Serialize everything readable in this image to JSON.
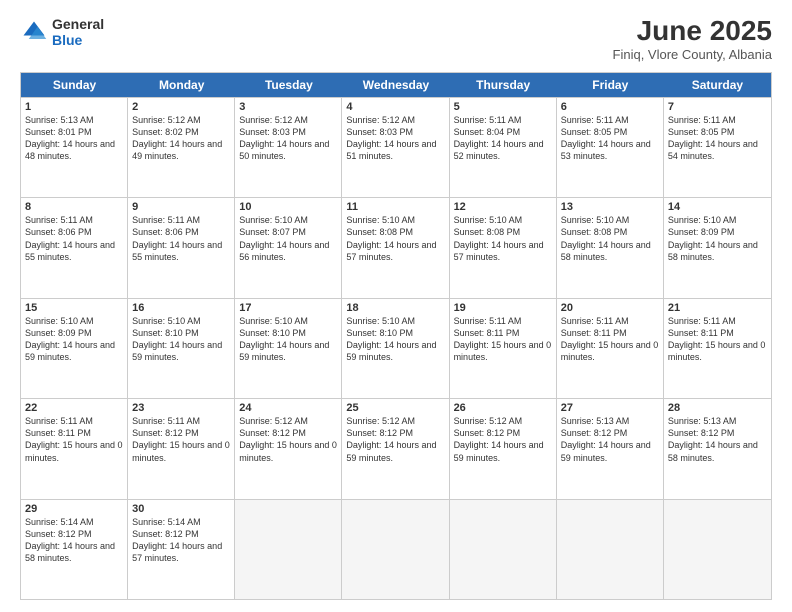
{
  "logo": {
    "general": "General",
    "blue": "Blue"
  },
  "title": {
    "month": "June 2025",
    "location": "Finiq, Vlore County, Albania"
  },
  "calendar": {
    "days": [
      "Sunday",
      "Monday",
      "Tuesday",
      "Wednesday",
      "Thursday",
      "Friday",
      "Saturday"
    ],
    "rows": [
      [
        {
          "day": "",
          "empty": true
        },
        {
          "day": "2",
          "sunrise": "5:12 AM",
          "sunset": "8:02 PM",
          "daylight": "14 hours and 49 minutes."
        },
        {
          "day": "3",
          "sunrise": "5:12 AM",
          "sunset": "8:03 PM",
          "daylight": "14 hours and 50 minutes."
        },
        {
          "day": "4",
          "sunrise": "5:12 AM",
          "sunset": "8:03 PM",
          "daylight": "14 hours and 51 minutes."
        },
        {
          "day": "5",
          "sunrise": "5:11 AM",
          "sunset": "8:04 PM",
          "daylight": "14 hours and 52 minutes."
        },
        {
          "day": "6",
          "sunrise": "5:11 AM",
          "sunset": "8:05 PM",
          "daylight": "14 hours and 53 minutes."
        },
        {
          "day": "7",
          "sunrise": "5:11 AM",
          "sunset": "8:05 PM",
          "daylight": "14 hours and 54 minutes."
        }
      ],
      [
        {
          "day": "8",
          "sunrise": "5:11 AM",
          "sunset": "8:06 PM",
          "daylight": "14 hours and 55 minutes."
        },
        {
          "day": "9",
          "sunrise": "5:11 AM",
          "sunset": "8:06 PM",
          "daylight": "14 hours and 55 minutes."
        },
        {
          "day": "10",
          "sunrise": "5:10 AM",
          "sunset": "8:07 PM",
          "daylight": "14 hours and 56 minutes."
        },
        {
          "day": "11",
          "sunrise": "5:10 AM",
          "sunset": "8:08 PM",
          "daylight": "14 hours and 57 minutes."
        },
        {
          "day": "12",
          "sunrise": "5:10 AM",
          "sunset": "8:08 PM",
          "daylight": "14 hours and 57 minutes."
        },
        {
          "day": "13",
          "sunrise": "5:10 AM",
          "sunset": "8:08 PM",
          "daylight": "14 hours and 58 minutes."
        },
        {
          "day": "14",
          "sunrise": "5:10 AM",
          "sunset": "8:09 PM",
          "daylight": "14 hours and 58 minutes."
        }
      ],
      [
        {
          "day": "15",
          "sunrise": "5:10 AM",
          "sunset": "8:09 PM",
          "daylight": "14 hours and 59 minutes."
        },
        {
          "day": "16",
          "sunrise": "5:10 AM",
          "sunset": "8:10 PM",
          "daylight": "14 hours and 59 minutes."
        },
        {
          "day": "17",
          "sunrise": "5:10 AM",
          "sunset": "8:10 PM",
          "daylight": "14 hours and 59 minutes."
        },
        {
          "day": "18",
          "sunrise": "5:10 AM",
          "sunset": "8:10 PM",
          "daylight": "14 hours and 59 minutes."
        },
        {
          "day": "19",
          "sunrise": "5:11 AM",
          "sunset": "8:11 PM",
          "daylight": "15 hours and 0 minutes."
        },
        {
          "day": "20",
          "sunrise": "5:11 AM",
          "sunset": "8:11 PM",
          "daylight": "15 hours and 0 minutes."
        },
        {
          "day": "21",
          "sunrise": "5:11 AM",
          "sunset": "8:11 PM",
          "daylight": "15 hours and 0 minutes."
        }
      ],
      [
        {
          "day": "22",
          "sunrise": "5:11 AM",
          "sunset": "8:11 PM",
          "daylight": "15 hours and 0 minutes."
        },
        {
          "day": "23",
          "sunrise": "5:11 AM",
          "sunset": "8:12 PM",
          "daylight": "15 hours and 0 minutes."
        },
        {
          "day": "24",
          "sunrise": "5:12 AM",
          "sunset": "8:12 PM",
          "daylight": "15 hours and 0 minutes."
        },
        {
          "day": "25",
          "sunrise": "5:12 AM",
          "sunset": "8:12 PM",
          "daylight": "14 hours and 59 minutes."
        },
        {
          "day": "26",
          "sunrise": "5:12 AM",
          "sunset": "8:12 PM",
          "daylight": "14 hours and 59 minutes."
        },
        {
          "day": "27",
          "sunrise": "5:13 AM",
          "sunset": "8:12 PM",
          "daylight": "14 hours and 59 minutes."
        },
        {
          "day": "28",
          "sunrise": "5:13 AM",
          "sunset": "8:12 PM",
          "daylight": "14 hours and 58 minutes."
        }
      ],
      [
        {
          "day": "29",
          "sunrise": "5:14 AM",
          "sunset": "8:12 PM",
          "daylight": "14 hours and 58 minutes."
        },
        {
          "day": "30",
          "sunrise": "5:14 AM",
          "sunset": "8:12 PM",
          "daylight": "14 hours and 57 minutes."
        },
        {
          "day": "",
          "empty": true
        },
        {
          "day": "",
          "empty": true
        },
        {
          "day": "",
          "empty": true
        },
        {
          "day": "",
          "empty": true
        },
        {
          "day": "",
          "empty": true
        }
      ]
    ],
    "first_row_special": {
      "day1": {
        "day": "1",
        "sunrise": "5:13 AM",
        "sunset": "8:01 PM",
        "daylight": "14 hours and 48 minutes."
      }
    }
  }
}
